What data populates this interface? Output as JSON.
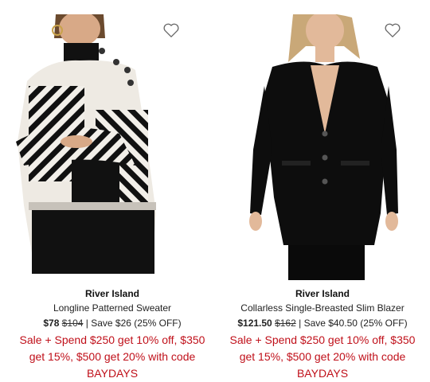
{
  "products": [
    {
      "brand": "River Island",
      "name": "Longline Patterned Sweater",
      "sale_price": "$78",
      "original_price": "$104",
      "savings": " | Save $26 (25% OFF)",
      "promo_line1": "Sale + Spend $250 get 10% off, $350",
      "promo_line2": "get 15%, $500 get 20% with code",
      "promo_line3": "BAYDAYS",
      "wishlist_icon": "heart-outline-icon"
    },
    {
      "brand": "River Island",
      "name": "Collarless Single-Breasted Slim Blazer",
      "sale_price": "$121.50",
      "original_price": "$162",
      "savings": " | Save $40.50 (25% OFF)",
      "promo_line1": "Sale + Spend $250 get 10% off, $350",
      "promo_line2": "get 15%, $500 get 20% with code",
      "promo_line3": "BAYDAYS",
      "wishlist_icon": "heart-outline-icon"
    }
  ],
  "colors": {
    "promo": "#c0101a",
    "text": "#222222"
  }
}
